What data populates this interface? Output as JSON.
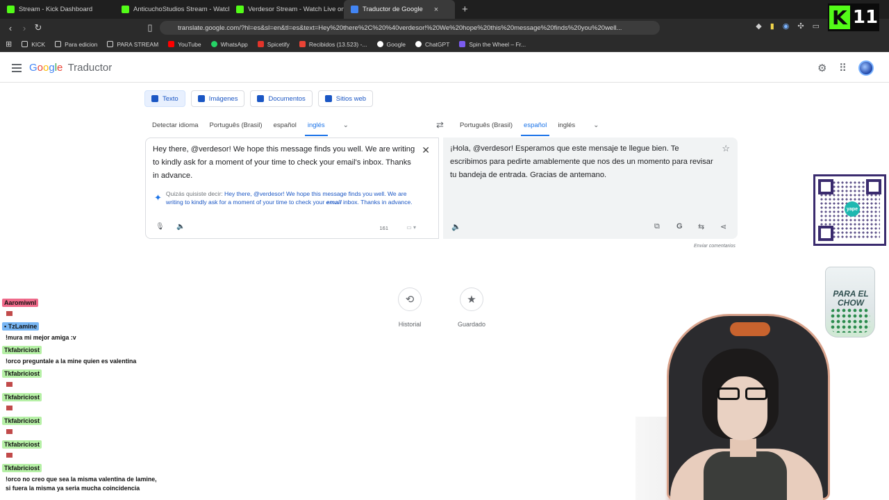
{
  "browser": {
    "tabs": [
      {
        "label": "Stream - Kick Dashboard",
        "color": "#53fc18"
      },
      {
        "label": "AnticuchoStudios Stream - Watch Liv",
        "color": "#53fc18"
      },
      {
        "label": "Verdesor Stream - Watch Live on Kick",
        "color": "#53fc18"
      },
      {
        "label": "Traductor de Google",
        "color": "#4285f4",
        "active": true
      }
    ],
    "new_tab": "+",
    "close_tab": "×",
    "url": "translate.google.com/?hl=es&sl=en&tl=es&text=Hey%20there%2C%20%40verdesor!%20We%20hope%20this%20message%20finds%20you%20well...",
    "bookmarks": [
      {
        "label": "KICK",
        "icon": "folder-icon"
      },
      {
        "label": "Para edicion",
        "icon": "folder-icon"
      },
      {
        "label": "PARA STREAM",
        "icon": "folder-icon"
      },
      {
        "label": "YouTube",
        "icon": "youtube-icon"
      },
      {
        "label": "WhatsApp",
        "icon": "whatsapp-icon"
      },
      {
        "label": "Spicetify",
        "icon": "spicetify-icon"
      },
      {
        "label": "Recibidos (13.523) -...",
        "icon": "gmail-icon"
      },
      {
        "label": "Google",
        "icon": "google-icon"
      },
      {
        "label": "ChatGPT",
        "icon": "chatgpt-icon"
      },
      {
        "label": "Spin the Wheel – Fr...",
        "icon": "wheel-icon"
      }
    ]
  },
  "kick_badge": {
    "number": "11",
    "letter": "K"
  },
  "header": {
    "logo_google": [
      "G",
      "o",
      "o",
      "g",
      "l",
      "e"
    ],
    "product": "Traductor"
  },
  "modes": [
    {
      "label": "Texto",
      "active": true
    },
    {
      "label": "Imágenes"
    },
    {
      "label": "Documentos"
    },
    {
      "label": "Sitios web"
    }
  ],
  "source_langs": [
    "Detectar idioma",
    "Português (Brasil)",
    "español",
    "inglés"
  ],
  "target_langs": [
    "Português (Brasil)",
    "español",
    "inglés"
  ],
  "source": {
    "text": "Hey there, @verdesor! We hope this message finds you well. We are writing to kindly ask for a moment of your time to check your email's inbox. Thanks in advance.",
    "did_you_mean_prefix": "Quizás quisiste decir:",
    "suggestion_a": "Hey there, @verdesor! We hope this message finds you well. We are writing to kindly ask for a moment of your time to check your",
    "suggestion_bold": "email",
    "suggestion_b": "inbox. Thanks in advance.",
    "char_count": "161"
  },
  "target": {
    "text": "¡Hola, @verdesor! Esperamos que este mensaje te llegue bien. Te escribimos para pedirte amablemente que nos des un momento para revisar tu bandeja de entrada. Gracias de antemano."
  },
  "feedback_label": "Enviar comentarios",
  "history_label": "Historial",
  "saved_label": "Guardado",
  "glass_text": "PARA EL CHOW",
  "qr_label": "yape",
  "chat": [
    {
      "user": "Aaromiwnl",
      "color": "pink",
      "emote": true
    },
    {
      "user": "TzLamine",
      "color": "blue",
      "text": "!mura mi mejor amiga :v"
    },
    {
      "user": "Tkfabriciost",
      "color": "green",
      "text": "!orco preguntale a la mine quien es valentina"
    },
    {
      "user": "Tkfabriciost",
      "color": "green",
      "emote": true
    },
    {
      "user": "Tkfabriciost",
      "color": "green",
      "emote": true
    },
    {
      "user": "Tkfabriciost",
      "color": "green",
      "emote": true
    },
    {
      "user": "Tkfabriciost",
      "color": "green",
      "emote": true
    },
    {
      "user": "Tkfabriciost",
      "color": "green",
      "text": "!orco no creo que sea la misma valentina de lamine, si fuera la misma ya seria mucha coincidencia"
    }
  ]
}
